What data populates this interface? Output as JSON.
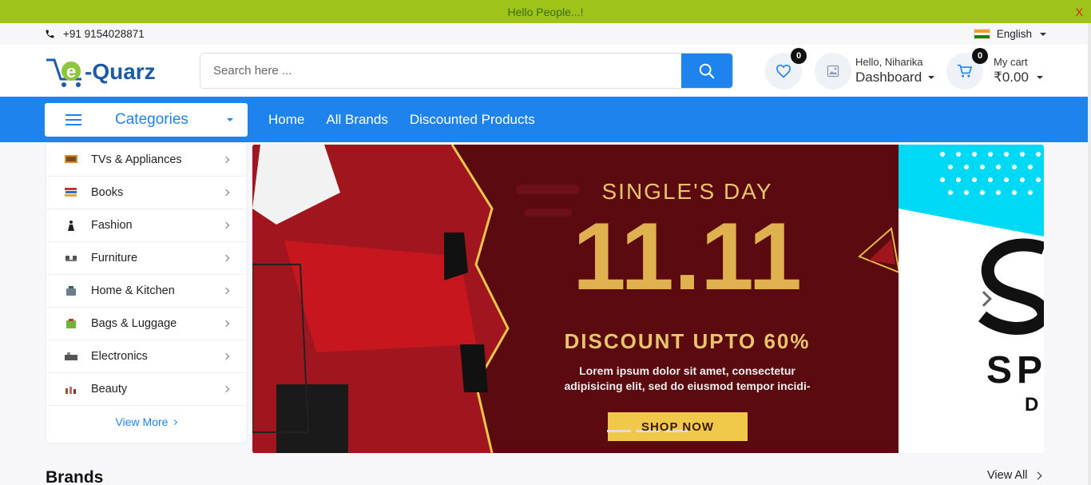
{
  "announcement": {
    "text": "Hello People...!",
    "close_label": "X"
  },
  "topbar": {
    "phone": "+91 9154028871",
    "language": "English"
  },
  "header": {
    "logo_text": "e-Quarz",
    "search_placeholder": "Search here ...",
    "wishlist_count": "0",
    "user_greeting": "Hello, Niharika",
    "dashboard_label": "Dashboard",
    "cart_label": "My cart",
    "cart_count": "0",
    "cart_total": "₹0.00"
  },
  "nav": {
    "categories_label": "Categories",
    "links": [
      "Home",
      "All Brands",
      "Discounted Products"
    ]
  },
  "categories": [
    {
      "label": "TVs & Appliances",
      "icon": "tv-icon"
    },
    {
      "label": "Books",
      "icon": "books-icon"
    },
    {
      "label": "Fashion",
      "icon": "fashion-icon"
    },
    {
      "label": "Furniture",
      "icon": "furniture-icon"
    },
    {
      "label": "Home & Kitchen",
      "icon": "kitchen-icon"
    },
    {
      "label": "Bags & Luggage",
      "icon": "bag-icon"
    },
    {
      "label": "Electronics",
      "icon": "electronics-icon"
    },
    {
      "label": "Beauty",
      "icon": "beauty-icon"
    }
  ],
  "view_more": "View More",
  "banner": {
    "heading": "SINGLE'S DAY",
    "big_number": "11.11",
    "discount": "DISCOUNT UPTO 60%",
    "body_line1": "Lorem ipsum dolor sit amet, consectetur",
    "body_line2": "adipisicing elit, sed do eiusmod tempor incidi-",
    "cta": "SHOP NOW"
  },
  "banner2": {
    "line1": "SP",
    "line2": "D"
  },
  "brands": {
    "title": "Brands",
    "view_all": "View All"
  },
  "colors": {
    "primary": "#1f83ee",
    "announce": "#9ec41a",
    "gold": "#e8c56b",
    "banner_bg": "#5b0a10"
  }
}
